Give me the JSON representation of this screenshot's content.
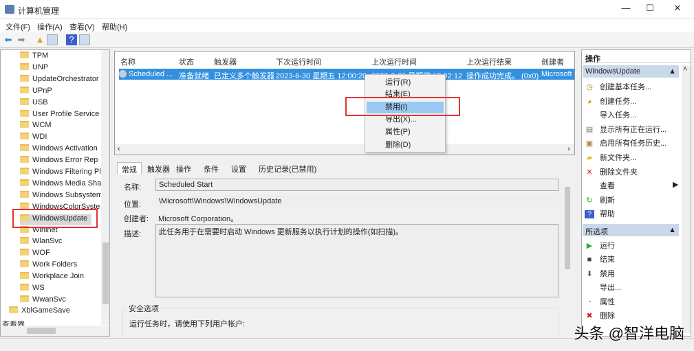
{
  "window": {
    "title": "计算机管理",
    "min": "—",
    "max": "☐",
    "close": "✕"
  },
  "menu": [
    "文件(F)",
    "操作(A)",
    "查看(V)",
    "帮助(H)"
  ],
  "tree": {
    "children": [
      "TPM",
      "UNP",
      "UpdateOrchestrator",
      "UPnP",
      "USB",
      "User Profile Service",
      "WCM",
      "WDI",
      "Windows Activation",
      "Windows Error Rep",
      "Windows Filtering Pl",
      "Windows Media Sha",
      "Windows Subsystem",
      "WindowsColorSyste",
      "WindowsUpdate",
      "Wininet",
      "WlanSvc",
      "WOF",
      "Work Folders",
      "Workplace Join",
      "WS",
      "WwanSvc"
    ],
    "selected": "WindowsUpdate",
    "sibling": "XblGameSave",
    "viewer": "查看器"
  },
  "list": {
    "headers": [
      "名称",
      "状态",
      "触发器",
      "下次运行时间",
      "上次运行时间",
      "上次运行结果",
      "创建者"
    ],
    "row": [
      "Scheduled ...",
      "准备就绪",
      "已定义多个触发器",
      "2023-6-30 星期五 12:00:20",
      "2023-6-29 星期四 12:02:12",
      "操作成功完成。 (0x0)",
      "Microsoft"
    ]
  },
  "context_menu": [
    "运行(R)",
    "结束(E)",
    "禁用(I)",
    "导出(X)...",
    "属性(P)",
    "删除(D)"
  ],
  "context_selected": "禁用(I)",
  "detail": {
    "tabs": [
      "常规",
      "触发器",
      "操作",
      "条件",
      "设置",
      "历史记录(已禁用)"
    ],
    "name_label": "名称:",
    "name": "Scheduled Start",
    "location_label": "位置:",
    "location": "\\Microsoft\\Windows\\WindowsUpdate",
    "author_label": "创建者:",
    "author": "Microsoft Corporation。",
    "desc_label": "描述:",
    "desc": "此任务用于在需要时启动 Windows 更新服务以执行计划的操作(如扫描)。",
    "security_title": "安全选项",
    "security_text": "运行任务时，请使用下列用户帐户:"
  },
  "actions": {
    "title": "操作",
    "section1": "WindowsUpdate",
    "items1": [
      "创建基本任务...",
      "创建任务...",
      "导入任务...",
      "显示所有正在运行...",
      "启用所有任务历史...",
      "新文件夹...",
      "删除文件夹",
      "查看",
      "刷新",
      "帮助"
    ],
    "section2": "所选项",
    "items2": [
      "运行",
      "结束",
      "禁用",
      "导出...",
      "属性",
      "删除"
    ]
  },
  "watermark": "头条 @智洋电脑"
}
